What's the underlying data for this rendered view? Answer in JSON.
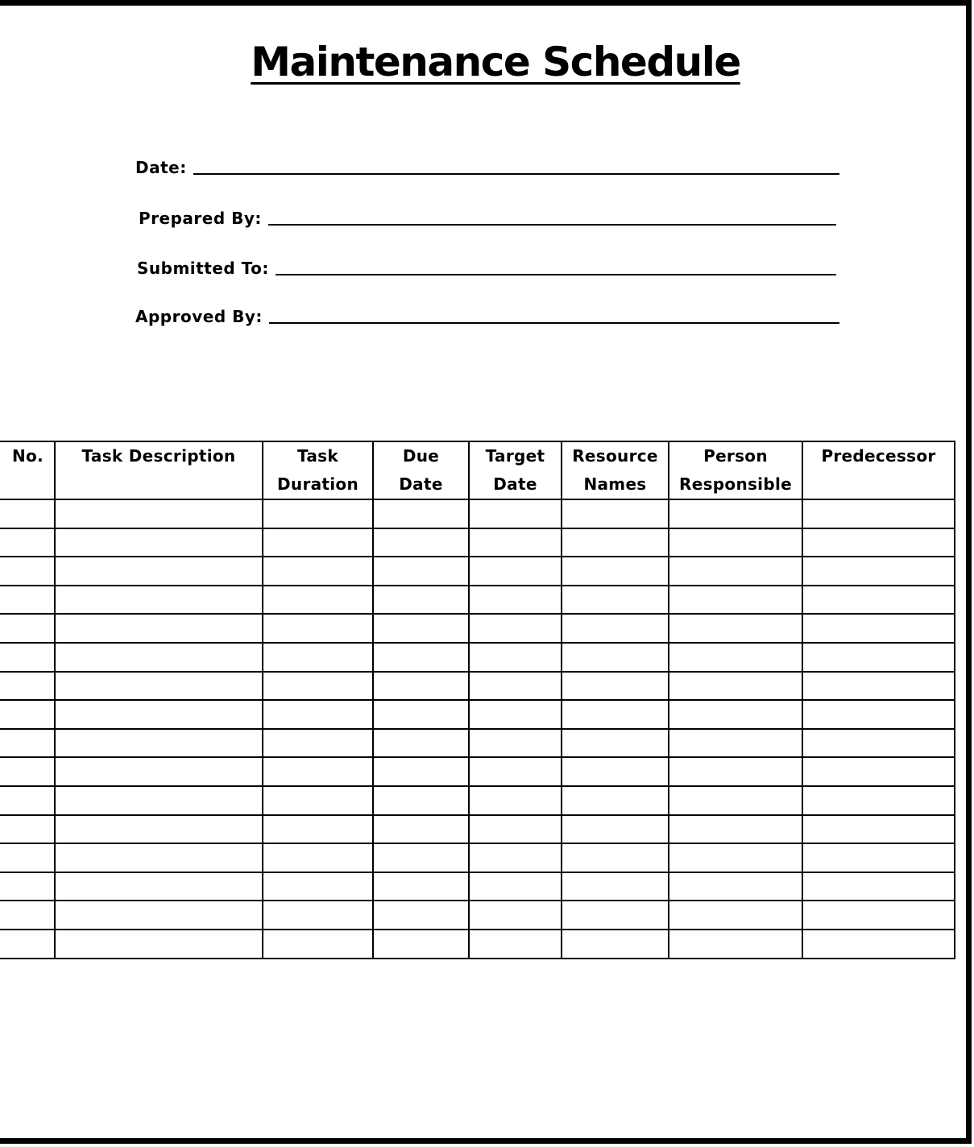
{
  "title": "Maintenance Schedule",
  "form_fields": [
    {
      "label": "Date:",
      "value": ""
    },
    {
      "label": "Prepared By:",
      "value": ""
    },
    {
      "label": "Submitted To:",
      "value": ""
    },
    {
      "label": "Approved By:",
      "value": ""
    }
  ],
  "table": {
    "headers": [
      {
        "line1": "No.",
        "line2": ""
      },
      {
        "line1": "Task Description",
        "line2": ""
      },
      {
        "line1": "Task",
        "line2": "Duration"
      },
      {
        "line1": "Due",
        "line2": "Date"
      },
      {
        "line1": "Target",
        "line2": "Date"
      },
      {
        "line1": "Resource",
        "line2": "Names"
      },
      {
        "line1": "Person",
        "line2": "Responsible"
      },
      {
        "line1": "Predecessor",
        "line2": ""
      }
    ],
    "row_count": 16,
    "rows": [
      [
        "",
        "",
        "",
        "",
        "",
        "",
        "",
        ""
      ],
      [
        "",
        "",
        "",
        "",
        "",
        "",
        "",
        ""
      ],
      [
        "",
        "",
        "",
        "",
        "",
        "",
        "",
        ""
      ],
      [
        "",
        "",
        "",
        "",
        "",
        "",
        "",
        ""
      ],
      [
        "",
        "",
        "",
        "",
        "",
        "",
        "",
        ""
      ],
      [
        "",
        "",
        "",
        "",
        "",
        "",
        "",
        ""
      ],
      [
        "",
        "",
        "",
        "",
        "",
        "",
        "",
        ""
      ],
      [
        "",
        "",
        "",
        "",
        "",
        "",
        "",
        ""
      ],
      [
        "",
        "",
        "",
        "",
        "",
        "",
        "",
        ""
      ],
      [
        "",
        "",
        "",
        "",
        "",
        "",
        "",
        ""
      ],
      [
        "",
        "",
        "",
        "",
        "",
        "",
        "",
        ""
      ],
      [
        "",
        "",
        "",
        "",
        "",
        "",
        "",
        ""
      ],
      [
        "",
        "",
        "",
        "",
        "",
        "",
        "",
        ""
      ],
      [
        "",
        "",
        "",
        "",
        "",
        "",
        "",
        ""
      ],
      [
        "",
        "",
        "",
        "",
        "",
        "",
        "",
        ""
      ],
      [
        "",
        "",
        "",
        "",
        "",
        "",
        "",
        ""
      ]
    ]
  }
}
